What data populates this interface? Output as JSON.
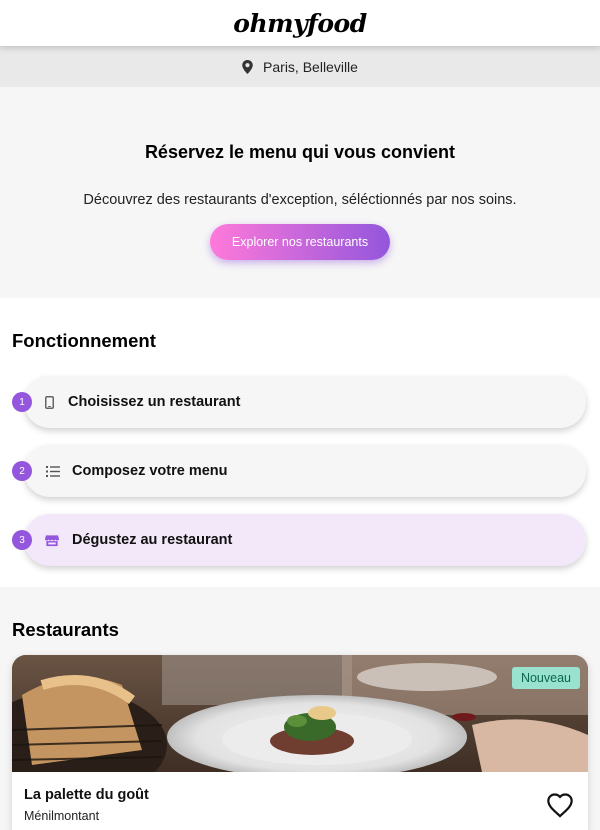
{
  "header": {
    "logo": "ohmyfood"
  },
  "location": {
    "icon": "map-pin-icon",
    "text": "Paris, Belleville"
  },
  "hero": {
    "title": "Réservez le menu qui vous convient",
    "subtitle": "Découvrez des restaurants d'exception, séléctionnés par nos soins.",
    "cta_label": "Explorer nos restaurants"
  },
  "how": {
    "title": "Fonctionnement",
    "steps": [
      {
        "num": "1",
        "icon": "phone-icon",
        "label": "Choisissez un restaurant"
      },
      {
        "num": "2",
        "icon": "list-icon",
        "label": "Composez votre menu"
      },
      {
        "num": "3",
        "icon": "store-icon",
        "label": "Dégustez au restaurant"
      }
    ]
  },
  "restaurants": {
    "title": "Restaurants",
    "items": [
      {
        "badge": "Nouveau",
        "name": "La palette du goût",
        "area": "Ménilmontant",
        "like_icon": "heart-outline-icon"
      }
    ]
  },
  "colors": {
    "accent_purple": "#9356dc",
    "accent_pink": "#ff79da",
    "badge_green": "#99e2d0",
    "active_step": "#f3e8fa"
  }
}
